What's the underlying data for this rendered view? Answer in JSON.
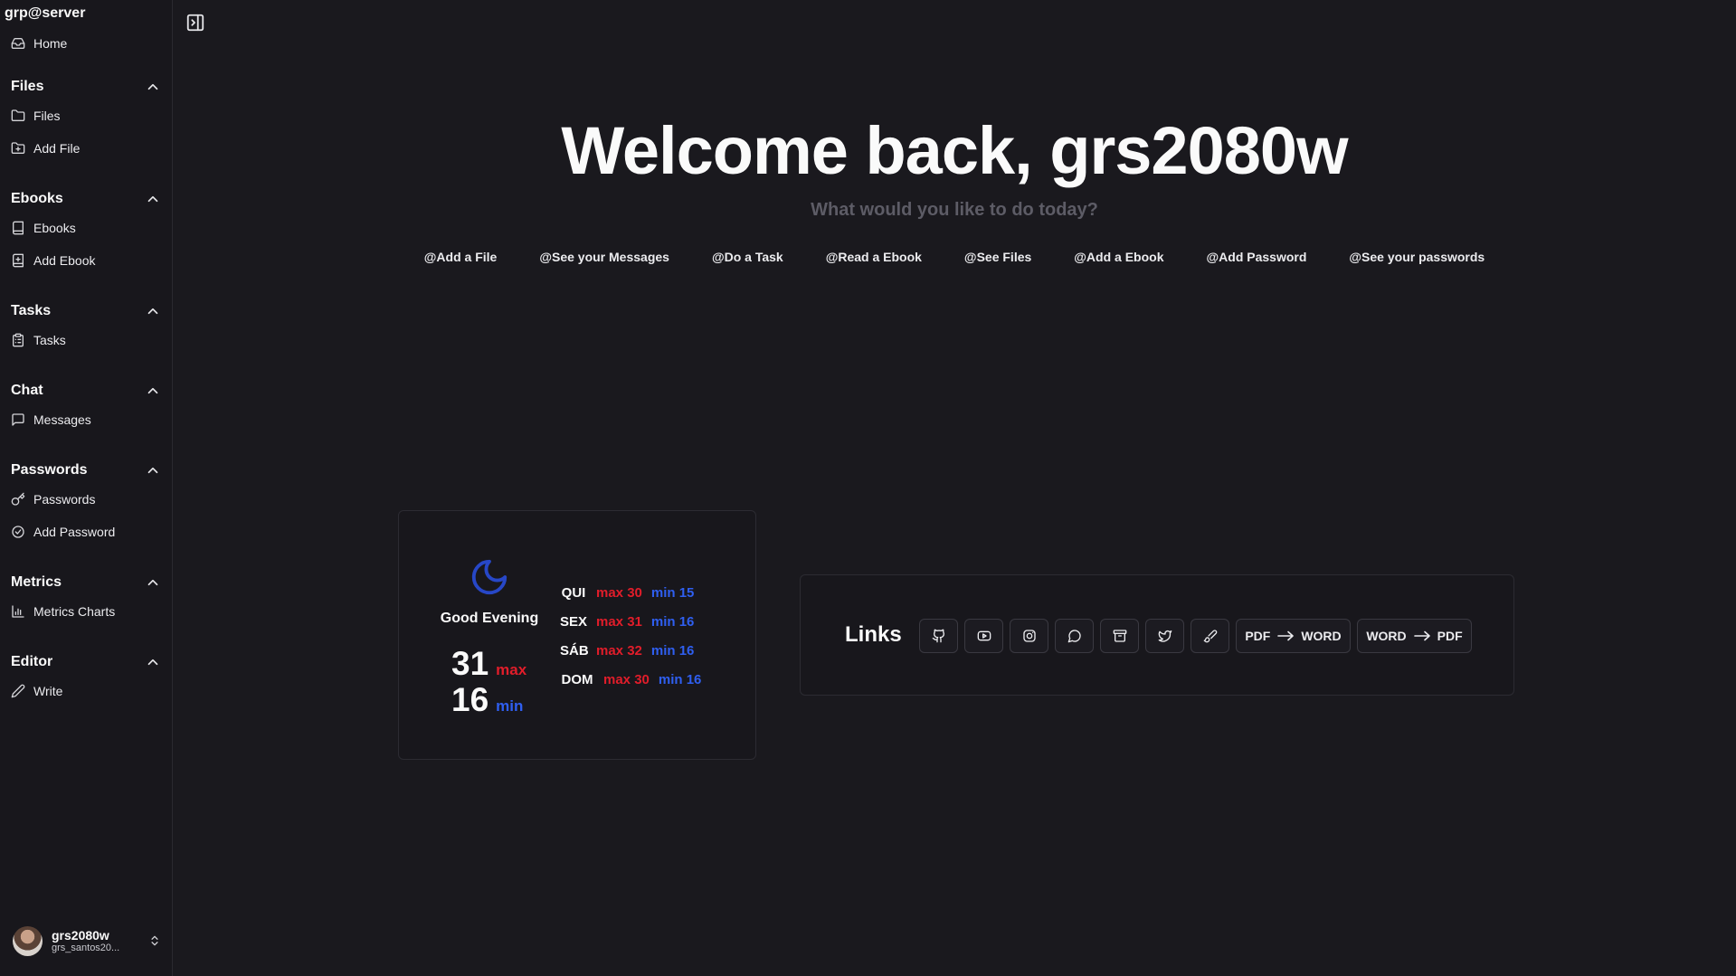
{
  "sidebar": {
    "brand": "grp@server",
    "home_label": "Home",
    "groups": [
      {
        "title": "Files",
        "items": [
          "Files",
          "Add File"
        ]
      },
      {
        "title": "Ebooks",
        "items": [
          "Ebooks",
          "Add Ebook"
        ]
      },
      {
        "title": "Tasks",
        "items": [
          "Tasks"
        ]
      },
      {
        "title": "Chat",
        "items": [
          "Messages"
        ]
      },
      {
        "title": "Passwords",
        "items": [
          "Passwords",
          "Add Password"
        ]
      },
      {
        "title": "Metrics",
        "items": [
          "Metrics Charts"
        ]
      },
      {
        "title": "Editor",
        "items": [
          "Write"
        ]
      }
    ],
    "user": {
      "name": "grs2080w",
      "email": "grs_santos20..."
    }
  },
  "hero": {
    "title": "Welcome back, grs2080w",
    "subtitle": "What would you like to do today?",
    "quick_links": [
      "@Add a File",
      "@See your Messages",
      "@Do a Task",
      "@Read a Ebook",
      "@See Files",
      "@Add a Ebook",
      "@Add Password",
      "@See your passwords"
    ]
  },
  "weather": {
    "icon": "moon-icon",
    "greeting": "Good Evening",
    "current_max": "31",
    "current_max_label": "max",
    "current_min": "16",
    "current_min_label": "min",
    "forecast": [
      {
        "day": "QUI",
        "max": "max 30",
        "min": "min 15"
      },
      {
        "day": "SEX",
        "max": "max 31",
        "min": "min 16"
      },
      {
        "day": "SÁB",
        "max": "max 32",
        "min": "min 16"
      },
      {
        "day": "DOM",
        "max": "max 30",
        "min": "min 16"
      }
    ],
    "colors": {
      "max": "#e11d2a",
      "min": "#2f5ff0",
      "moon": "#2747c7"
    }
  },
  "links": {
    "title": "Links",
    "icon_buttons": [
      "github-icon",
      "youtube-icon",
      "instagram-icon",
      "chat-bubble-icon",
      "archive-icon",
      "twitter-icon",
      "brush-icon"
    ],
    "convert_buttons": [
      {
        "from": "PDF",
        "to": "WORD"
      },
      {
        "from": "WORD",
        "to": "PDF"
      }
    ]
  }
}
